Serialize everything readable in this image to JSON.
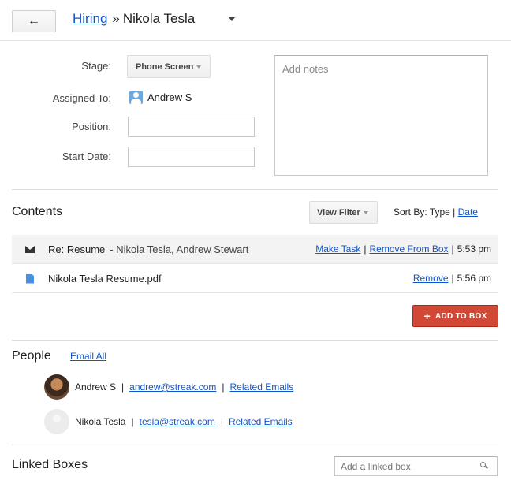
{
  "header": {
    "back_icon": "back-arrow-icon",
    "breadcrumb_link": "Hiring",
    "breadcrumb_sep": "»",
    "box_name": "Nikola Tesla"
  },
  "fields": {
    "stage_label": "Stage:",
    "stage_value": "Phone Screen",
    "assigned_label": "Assigned To:",
    "assigned_value": "Andrew S",
    "position_label": "Position:",
    "position_value": "",
    "start_date_label": "Start Date:",
    "start_date_value": "",
    "notes_placeholder": "Add notes"
  },
  "contents": {
    "title": "Contents",
    "view_filter": "View Filter",
    "sort_by_label": "Sort By: Type |",
    "sort_by_link": "Date",
    "rows": [
      {
        "type": "email",
        "icon": "envelope-icon",
        "subject": "Re: Resume",
        "people": "-  Nikola Tesla, Andrew Stewart",
        "action1": "Make Task",
        "action2": "Remove From Box",
        "time": "5:53 pm"
      },
      {
        "type": "file",
        "icon": "file-icon",
        "subject": "Nikola Tesla Resume.pdf",
        "action1": "Remove",
        "time": "5:56 pm"
      }
    ],
    "add_button": "ADD TO BOX",
    "add_button_icon": "+"
  },
  "people": {
    "title": "People",
    "email_all": "Email All",
    "list": [
      {
        "name": "Andrew S",
        "email": "andrew@streak.com",
        "related": "Related Emails"
      },
      {
        "name": "Nikola Tesla",
        "email": "tesla@streak.com",
        "related": "Related Emails"
      }
    ]
  },
  "linked": {
    "title": "Linked Boxes",
    "placeholder": "Add a linked box"
  },
  "colors": {
    "link": "#1155cc",
    "primary_button": "#d14836",
    "selected_row": "#f3f3f3"
  }
}
